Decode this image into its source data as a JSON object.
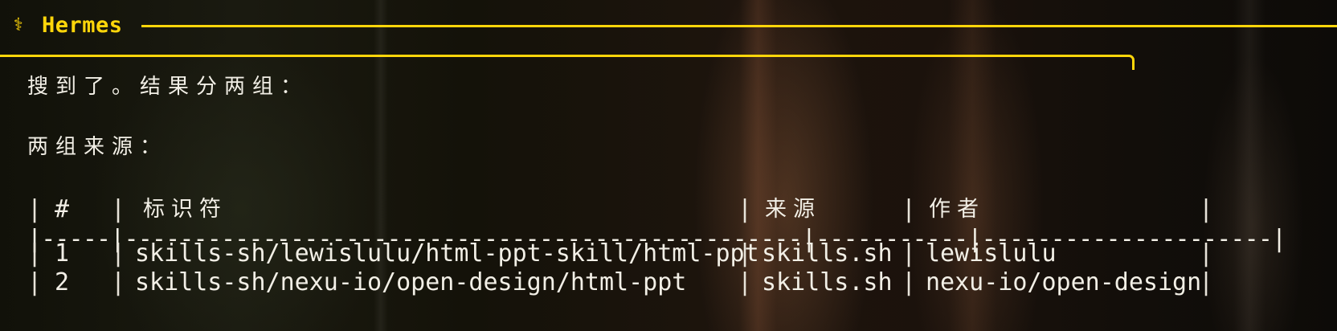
{
  "app": {
    "icon": "⚕",
    "title": "Hermes",
    "accent_color": "#ffd60a",
    "text_color": "#f2efe6"
  },
  "message": {
    "line1": "搜到了。结果分两组：",
    "line2": "两组来源："
  },
  "table": {
    "headers": [
      "#",
      "标识符",
      "来源",
      "作者"
    ],
    "separator": "|-----|-------------------------------------------------|-----------|---------------------|",
    "rows": [
      [
        "1",
        "skills-sh/lewislulu/html-ppt-skill/html-ppt",
        "skills.sh",
        "lewislulu"
      ],
      [
        "2",
        "skills-sh/nexu-io/open-design/html-ppt",
        "skills.sh",
        "nexu-io/open-design"
      ]
    ]
  }
}
